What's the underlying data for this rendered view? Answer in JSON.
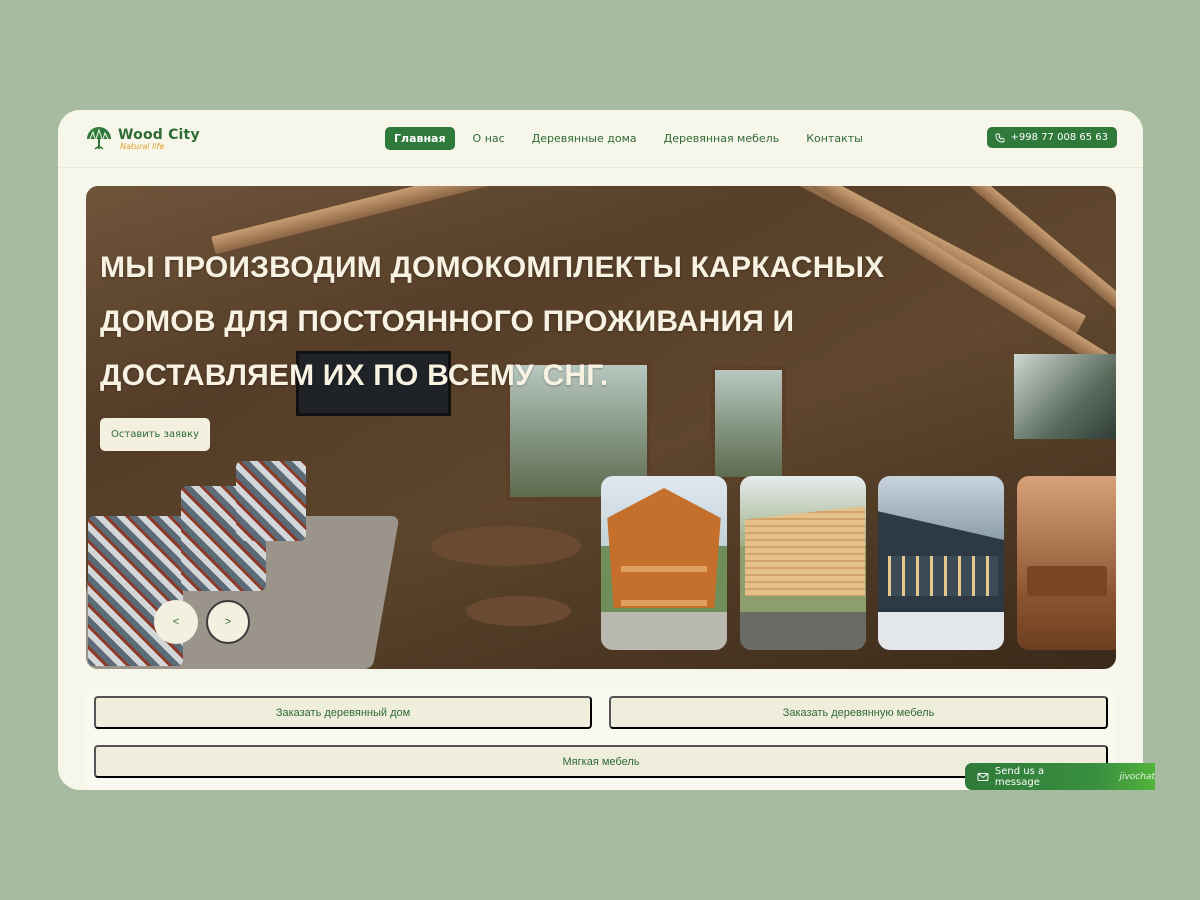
{
  "brand": {
    "name": "Wood City",
    "tagline": "Natural life",
    "colors": {
      "primary": "#2f7a3a",
      "accent": "#e0a12a",
      "background": "#f7f6ea"
    }
  },
  "nav": {
    "items": [
      {
        "label": "Главная",
        "active": true
      },
      {
        "label": "О нас",
        "active": false
      },
      {
        "label": "Деревянные дома",
        "active": false
      },
      {
        "label": "Деревянная мебель",
        "active": false
      },
      {
        "label": "Контакты",
        "active": false
      }
    ]
  },
  "header": {
    "phone": "+998 77 008 65 63",
    "phone_icon": "phone-icon"
  },
  "hero": {
    "title_lines": [
      "МЫ ПРОИЗВОДИМ ДОМОКОМПЛЕКТЫ КАРКАСНЫХ",
      "ДОМОВ ДЛЯ ПОСТОЯННОГО ПРОЖИВАНИЯ И",
      "ДОСТАВЛЯЕМ ИХ ПО ВСЕМУ СНГ."
    ],
    "cta_label": "Оставить заявку",
    "prev_label": "<",
    "next_label": ">"
  },
  "actions": {
    "order_house": "Заказать деревянный дом",
    "order_furniture": "Заказать деревянную мебель",
    "soft_furniture": "Мягкая мебель"
  },
  "chat": {
    "label": "Send us a message",
    "brand": "jivochat",
    "icon": "mail-icon"
  }
}
